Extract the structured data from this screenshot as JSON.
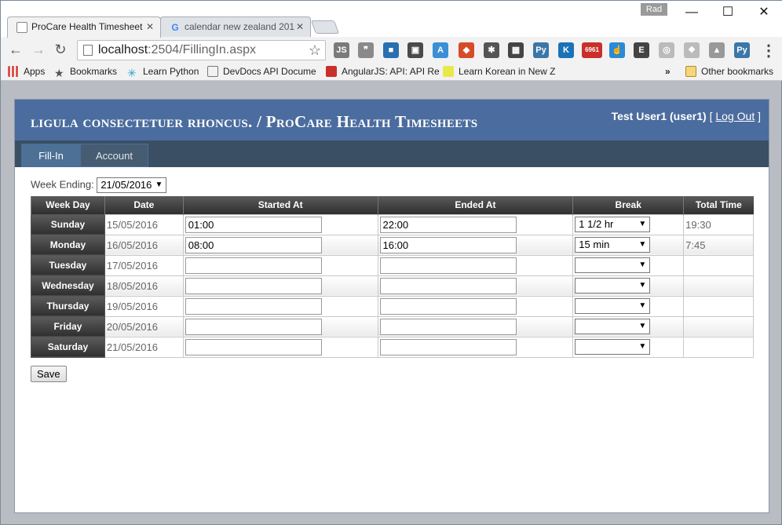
{
  "browser": {
    "profile_label": "Rad",
    "tabs": [
      {
        "title": "ProCare Health Timesheet"
      },
      {
        "title": "calendar new zealand 201"
      }
    ],
    "url_host": "localhost",
    "url_rest": ":2504/FillingIn.aspx",
    "extensions": [
      {
        "name": "js-extension-icon",
        "label": "JS",
        "color": "#7a7a7a"
      },
      {
        "name": "chat-icon",
        "label": "❞",
        "color": "#8a8a8a"
      },
      {
        "name": "cube-icon",
        "label": "■",
        "color": "#2a6fb0"
      },
      {
        "name": "screenshot-icon",
        "label": "▣",
        "color": "#4a4a4a"
      },
      {
        "name": "app-a-icon",
        "label": "A",
        "color": "#3b8fd4"
      },
      {
        "name": "color-picker-icon",
        "label": "◆",
        "color": "#d64b2a"
      },
      {
        "name": "bug-icon",
        "label": "✱",
        "color": "#555"
      },
      {
        "name": "qr-icon",
        "label": "▦",
        "color": "#444"
      },
      {
        "name": "python-icon",
        "label": "Py",
        "color": "#3b77a8"
      },
      {
        "name": "k-icon",
        "label": "K",
        "color": "#1a72b8"
      },
      {
        "name": "gmail-count-icon",
        "label": "6961",
        "color": "#c9302c"
      },
      {
        "name": "touch-icon",
        "label": "☝",
        "color": "#2a8ad6"
      },
      {
        "name": "evernote-icon",
        "label": "E",
        "color": "#444"
      },
      {
        "name": "circle-icon",
        "label": "◎",
        "color": "#bbb"
      },
      {
        "name": "dropbox-icon",
        "label": "❖",
        "color": "#bbb"
      },
      {
        "name": "drive-icon",
        "label": "▲",
        "color": "#999"
      },
      {
        "name": "python2-icon",
        "label": "Py",
        "color": "#3b77a8"
      }
    ],
    "bookmarks": [
      {
        "label": "Apps",
        "color": "#d9534f"
      },
      {
        "label": "Bookmarks",
        "color": "#555"
      },
      {
        "label": "Learn Python",
        "color": "#2aa2c9"
      },
      {
        "label": "DevDocs API Docume",
        "color": "#888"
      },
      {
        "label": "AngularJS: API: API Re",
        "color": "#c9302c"
      },
      {
        "label": "Learn Korean in New Z",
        "color": "#d6d62a"
      }
    ],
    "other_bookmarks": "Other bookmarks"
  },
  "site": {
    "title": "ligula consectetuer rhoncus. / ProCare Health Timesheets",
    "user_display": "Test User1 (user1)",
    "logout_label": "Log Out",
    "menu": [
      "Fill-In",
      "Account"
    ]
  },
  "form": {
    "week_label": "Week Ending:",
    "week_value": "21/05/2016",
    "columns": [
      "Week Day",
      "Date",
      "Started At",
      "Ended At",
      "Break",
      "Total Time"
    ],
    "rows": [
      {
        "day": "Sunday",
        "date": "15/05/2016",
        "start": "01:00",
        "end": "22:00",
        "break": "1 1/2 hr",
        "total": "19:30"
      },
      {
        "day": "Monday",
        "date": "16/05/2016",
        "start": "08:00",
        "end": "16:00",
        "break": "15 min",
        "total": "7:45"
      },
      {
        "day": "Tuesday",
        "date": "17/05/2016",
        "start": "",
        "end": "",
        "break": "",
        "total": ""
      },
      {
        "day": "Wednesday",
        "date": "18/05/2016",
        "start": "",
        "end": "",
        "break": "",
        "total": ""
      },
      {
        "day": "Thursday",
        "date": "19/05/2016",
        "start": "",
        "end": "",
        "break": "",
        "total": ""
      },
      {
        "day": "Friday",
        "date": "20/05/2016",
        "start": "",
        "end": "",
        "break": "",
        "total": ""
      },
      {
        "day": "Saturday",
        "date": "21/05/2016",
        "start": "",
        "end": "",
        "break": "",
        "total": ""
      }
    ],
    "save_label": "Save"
  }
}
